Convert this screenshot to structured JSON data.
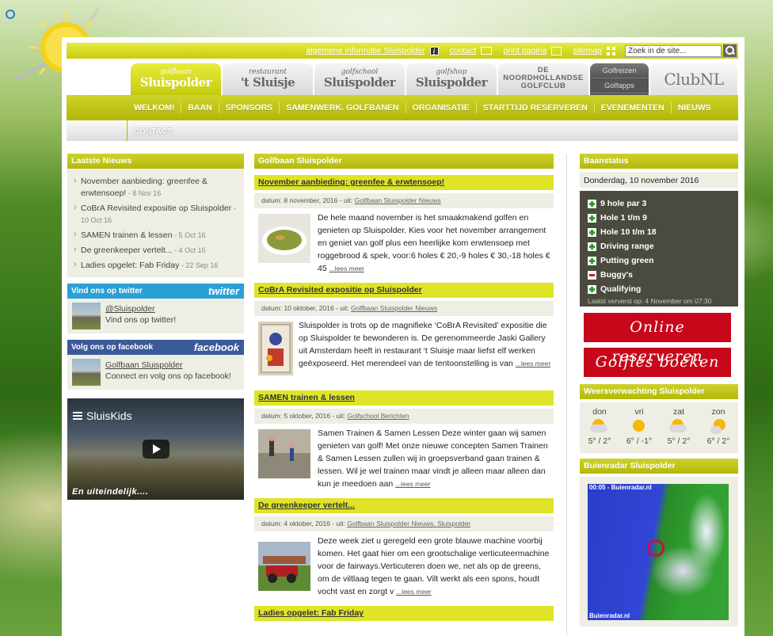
{
  "util": {
    "info_link": "algemene informatie Sluispolder",
    "contact_link": "contact",
    "print_link": "print pagina",
    "sitemap_link": "sitemap",
    "search_placeholder": "Zoek in de site..."
  },
  "brand_tabs": [
    {
      "small": "golfbaan",
      "big": "Sluispolder"
    },
    {
      "small": "restaurant",
      "big": "'t Sluisje"
    },
    {
      "small": "golfschool",
      "big": "Sluispolder"
    },
    {
      "small": "golfshop",
      "big": "Sluispolder"
    },
    {
      "line1": "DE",
      "line2": "NOORDHOLLANDSE",
      "line3": "GOLFCLUB"
    },
    {
      "top": "Golfreizen",
      "bottom": "Golfapps"
    },
    {
      "label": "ClubNL"
    }
  ],
  "nav": [
    "WELKOM!",
    "BAAN",
    "SPONSORS",
    "SAMENWERK. GOLFBANEN",
    "ORGANISATIE",
    "STARTTIJD RESERVEREN",
    "EVENEMENTEN",
    "NIEUWS"
  ],
  "subnav": "CONTACT",
  "left": {
    "news_title": "Laatste Nieuws",
    "news": [
      {
        "title": "November aanbieding: greenfee & erwtensoep!",
        "date": " - 8 Nov 16"
      },
      {
        "title": "CoBrA Revisited expositie op Sluispolder",
        "date": " - 10 Oct 16"
      },
      {
        "title": "SAMEN trainen & lessen",
        "date": " - 5 Oct 16"
      },
      {
        "title": "De greenkeeper vertelt...",
        "date": " - 4 Oct 16"
      },
      {
        "title": "Ladies opgelet: Fab Friday",
        "date": " - 22 Sep 16"
      }
    ],
    "twitter_title": "Vind ons op twitter",
    "twitter_brand": "twitter",
    "twitter_link": "@Sluispolder",
    "twitter_text": "Vind ons op twitter!",
    "facebook_title": "Volg ons op facebook",
    "facebook_brand": "facebook",
    "facebook_link": "Golfbaan Sluispolder",
    "facebook_text": "Connect en volg ons op facebook!",
    "video_title": "SluisKids",
    "video_caption": "En uiteindelijk...."
  },
  "center": {
    "title": "Golfbaan Sluispolder",
    "articles": [
      {
        "title": "November aanbieding: greenfee & erwtensoep!",
        "meta_date": "datum: 8 november, 2016 - ",
        "meta_uit": "uit: ",
        "meta_src": "Golfbaan Sluispolder Nieuws",
        "text": "De hele maand november is het smaakmakend golfen en genieten op Sluispolder. Kies voor het november arrangement en geniet van golf plus een heerlijke kom erwtensoep met roggebrood & spek, voor:6 holes € 20,-9 holes € 30,-18 holes € 45 ",
        "more": "...lees meer"
      },
      {
        "title": "CoBrA Revisited expositie op Sluispolder",
        "meta_date": "datum: 10 oktober, 2016 - ",
        "meta_uit": "uit: ",
        "meta_src": "Golfbaan Sluispolder Nieuws",
        "text": "Sluispolder is trots op de magnifieke ‘CoBrA Revisited’ expositie die op Sluispolder te bewonderen is.  De gerenommeerde Jaski Gallery uit Amsterdam heeft in restaurant ‘t Sluisje maar liefst elf werken geëxposeerd. Het merendeel van de tentoonstelling is van ",
        "more": "...lees meer"
      },
      {
        "title": "SAMEN trainen & lessen",
        "meta_date": "datum: 5 oktober, 2016 - ",
        "meta_uit": "uit: ",
        "meta_src": "Golfschool Berichten",
        "text": "Samen Trainen & Samen Lessen Deze winter gaan wij samen genieten van golf! Met onze nieuwe concepten Samen Trainen & Samen Lessen zullen wij in groepsverband gaan trainen & lessen. Wil je wel trainen maar vindt je alleen maar alleen dan kun je meedoen aan ",
        "more": "...lees meer"
      },
      {
        "title": "De greenkeeper vertelt...",
        "meta_date": "datum: 4 oktober, 2016 - ",
        "meta_uit": "uit: ",
        "meta_src": "Golfbaan Sluispolder Nieuws, Sluispolder",
        "text": "Deze week ziet u geregeld een grote blauwe machine voorbij komen. Het gaat hier om een grootschalige verticuteermachine voor de fairways.Verticuteren doen we, net als op de greens, om de viltlaag tegen te gaan. Vilt werkt als een spons, houdt vocht vast en zorgt v ",
        "more": "...lees meer"
      },
      {
        "title": "Ladies opgelet: Fab Friday"
      }
    ]
  },
  "right": {
    "baan_title": "Baanstatus",
    "baan_date": "Donderdag, 10 november 2016",
    "baan_items": [
      {
        "label": "9 hole par 3",
        "state": "plus"
      },
      {
        "label": "Hole 1 t/m 9",
        "state": "plus"
      },
      {
        "label": "Hole 10 t/m 18",
        "state": "plus"
      },
      {
        "label": "Driving range",
        "state": "plus"
      },
      {
        "label": "Putting green",
        "state": "plus"
      },
      {
        "label": "Buggy's",
        "state": "minus"
      },
      {
        "label": "Qualifying",
        "state": "plus"
      }
    ],
    "baan_note": "Laatst ververst op: 4 November om 07:30",
    "btn_reserve": "Online reserveren",
    "btn_golfles": "Golfles boeken",
    "weer_title": "Weersverwachting Sluispolder",
    "weer": [
      {
        "day": "don",
        "temp": "5° / 2°",
        "icon": "cloud-sun-icon"
      },
      {
        "day": "vri",
        "temp": "6° / -1°",
        "icon": "sun-icon"
      },
      {
        "day": "zat",
        "temp": "5° / 2°",
        "icon": "cloud-sun-icon"
      },
      {
        "day": "zon",
        "temp": "6° / 2°",
        "icon": "sun-cloud-icon"
      }
    ],
    "radar_title": "Buienradar Sluispolder",
    "radar_header": "00:05 - Buienradar.nl",
    "radar_footer": "Buienradar.nl"
  },
  "colors": {
    "accent": "#c8cc10",
    "twitter": "#2aa0d6",
    "facebook": "#3b5a98",
    "red": "#c7071a"
  }
}
